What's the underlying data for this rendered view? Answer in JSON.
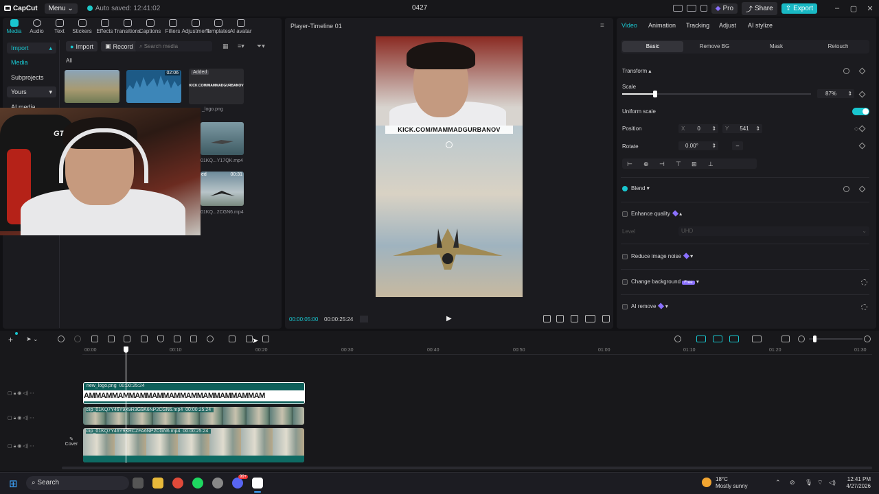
{
  "app": {
    "name": "CapCut",
    "menu_label": "Menu",
    "autosave": "Auto saved: 12:41:02",
    "project_name": "0427",
    "pro_label": "Pro",
    "share_label": "Share",
    "export_label": "Export"
  },
  "toolbar": {
    "items": [
      {
        "label": "Media",
        "active": true
      },
      {
        "label": "Audio"
      },
      {
        "label": "Text"
      },
      {
        "label": "Stickers"
      },
      {
        "label": "Effects"
      },
      {
        "label": "Transitions"
      },
      {
        "label": "Captions"
      },
      {
        "label": "Filters"
      },
      {
        "label": "Adjustment"
      },
      {
        "label": "Templates"
      },
      {
        "label": "AI avatar"
      }
    ]
  },
  "leftnav": {
    "import_label": "Import",
    "media_label": "Media",
    "subprojects_label": "Subprojects",
    "yours_label": "Yours",
    "ai_media_label": "AI media"
  },
  "media": {
    "import_button": "Import",
    "record_button": "Record",
    "search_placeholder": "Search media",
    "filter_all": "All",
    "audio_duration": "02:06",
    "added_label": "Added",
    "logo_text": "KICK.COM/MAMMADGURBANOV",
    "logo_filename": "_logo.png",
    "clip1_name": "01KQ...Y17QK.mp4",
    "clip2_duration": "00:31",
    "clip2_name": "01KQ...2CGN6.mp4",
    "clip2_tag": "ed"
  },
  "player": {
    "title": "Player-Timeline 01",
    "banner_text": "KICK.COM/MAMMADGURBANOV",
    "chair_text": "GTR",
    "current_time": "00:00:05:00",
    "total_time": "00:00:25:24"
  },
  "inspector": {
    "tabs": [
      "Video",
      "Animation",
      "Tracking",
      "Adjust",
      "AI stylize"
    ],
    "subtabs": [
      "Basic",
      "Remove BG",
      "Mask",
      "Retouch"
    ],
    "transform_label": "Transform",
    "scale_label": "Scale",
    "scale_value": "87%",
    "scale_fraction": 0.87,
    "uniform_scale_label": "Uniform scale",
    "position_label": "Position",
    "pos_x_label": "X",
    "pos_x": "0",
    "pos_y_label": "Y",
    "pos_y": "541",
    "rotate_label": "Rotate",
    "rotate_value": "0.00°",
    "blend_label": "Blend",
    "enhance_label": "Enhance quality",
    "level_label": "Level",
    "level_value": "UHD",
    "noise_label": "Reduce image noise",
    "bg_label": "Change background",
    "free_badge": "Free",
    "ai_remove_label": "AI remove"
  },
  "timeline": {
    "ruler": [
      "00:00",
      "00:10",
      "00:20",
      "00:30",
      "00:40",
      "00:50",
      "01:00",
      "01:10",
      "01:20",
      "01:30"
    ],
    "track1_label": "new_logo.png",
    "track1_duration": "00:00:25:24",
    "track1_text": "AMMAMMAMMAMMAMMAMMAMMAMMAMMAMMAM",
    "track2_label": "clip_01KQ7Y46Y9X9R3G9A6NP2CGN6.mp4",
    "track2_duration": "00:00:25:24",
    "track3_label": "clip_01KQ7Y46Y9XRCZFA6NP2CGN6.mp4",
    "track3_duration": "00:00:25:24",
    "cover_label": "Cover"
  },
  "taskbar": {
    "search_label": "Search",
    "weather_temp": "18°C",
    "weather_desc": "Mostly sunny",
    "time": "12:41 PM",
    "date": "4/27/2026",
    "badge": "99+"
  },
  "colors": {
    "accent": "#19c6cf",
    "export": "#19b9c4",
    "panel": "#1b1b1f",
    "bg": "#111114"
  }
}
